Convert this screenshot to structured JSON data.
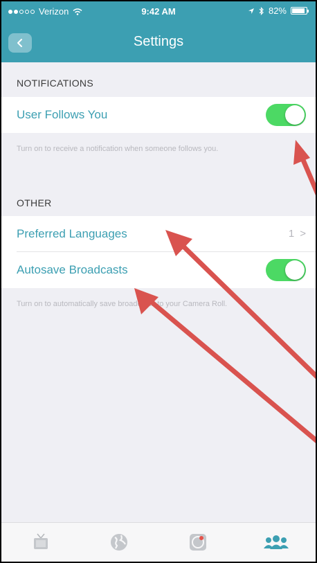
{
  "status_bar": {
    "carrier": "Verizon",
    "time": "9:42 AM",
    "battery": "82%"
  },
  "nav": {
    "title": "Settings"
  },
  "sections": {
    "notifications": {
      "header": "NOTIFICATIONS",
      "user_follows": {
        "label": "User Follows You",
        "enabled": true,
        "note": "Turn on to receive a notification when someone follows you."
      }
    },
    "other": {
      "header": "OTHER",
      "preferred_languages": {
        "label": "Preferred Languages",
        "value": "1",
        "chevron": ">"
      },
      "autosave": {
        "label": "Autosave Broadcasts",
        "enabled": true,
        "note": "Turn on to automatically save broadcasts to your Camera Roll."
      }
    }
  },
  "tab_bar": {
    "items": [
      {
        "icon": "tv-icon",
        "active": false
      },
      {
        "icon": "globe-icon",
        "active": false
      },
      {
        "icon": "broadcast-icon",
        "active": false
      },
      {
        "icon": "people-icon",
        "active": true
      }
    ]
  },
  "colors": {
    "accent": "#3c9fb2",
    "toggle_on": "#4cd964",
    "annotation_arrow": "#d9534f"
  }
}
